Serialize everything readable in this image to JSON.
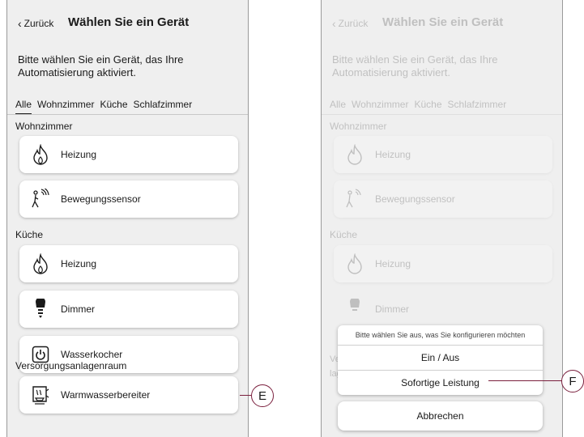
{
  "left_screen": {
    "back_label": "Zurück",
    "title": "Wählen Sie ein Gerät",
    "subtitle": "Bitte wählen Sie ein Gerät, das Ihre Automatisierung aktiviert.",
    "tabs": [
      "Alle",
      "Wohnzimmer",
      "Küche",
      "Schlafzimmer"
    ],
    "sections": [
      {
        "name": "Wohnzimmer",
        "devices": [
          {
            "label": "Heizung",
            "icon": "flame-icon"
          },
          {
            "label": "Bewegungssensor",
            "icon": "motion-sensor-icon"
          }
        ]
      },
      {
        "name": "Küche",
        "devices": [
          {
            "label": "Heizung",
            "icon": "flame-icon"
          },
          {
            "label": "Dimmer",
            "icon": "bulb-icon"
          },
          {
            "label": "Wasserkocher",
            "icon": "power-socket-icon"
          }
        ]
      },
      {
        "name": "Versorgungsanlagenraum",
        "devices": [
          {
            "label": "Warmwasserbereiter",
            "icon": "water-heater-icon"
          }
        ]
      }
    ]
  },
  "right_screen": {
    "action_sheet": {
      "prompt": "Bitte wählen Sie aus, was Sie konfigurieren möchten",
      "options": [
        "Ein / Aus",
        "Sofortige Leistung"
      ],
      "cancel_label": "Abbrechen"
    },
    "peek_text": [
      "Ve",
      "lagenraum"
    ]
  },
  "callouts": {
    "e": "E",
    "f": "F"
  },
  "colors": {
    "callout": "#7a1f3d",
    "background": "#efefef",
    "card": "#ffffff"
  }
}
